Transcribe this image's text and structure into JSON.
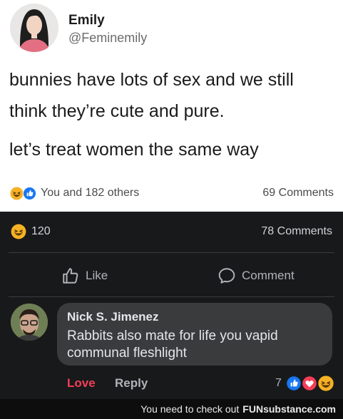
{
  "tweet": {
    "author_name": "Emily",
    "author_handle": "@Feminemily",
    "lines": [
      "bunnies have lots of sex and we still",
      "think they’re cute and pure.",
      "let’s treat women the same way"
    ],
    "reactions_text": "You and 182 others",
    "comments_count": "69 Comments"
  },
  "fb": {
    "reactions_count": "120",
    "comments_count": "78 Comments",
    "like_label": "Like",
    "comment_label": "Comment",
    "comment": {
      "author": "Nick S. Jimenez",
      "text": "Rabbits also mate for life you vapid communal fleshlight",
      "love_label": "Love",
      "reply_label": "Reply",
      "reaction_count": "7"
    }
  },
  "watermark": {
    "text": "You need to check out",
    "brand": "FUNsubstance.com"
  },
  "colors": {
    "love_red": "#f33e58",
    "like_blue": "#1877f2",
    "haha_yellow": "#f7b125",
    "dark_bg": "#18191a",
    "bubble_bg": "#3a3b3c"
  }
}
